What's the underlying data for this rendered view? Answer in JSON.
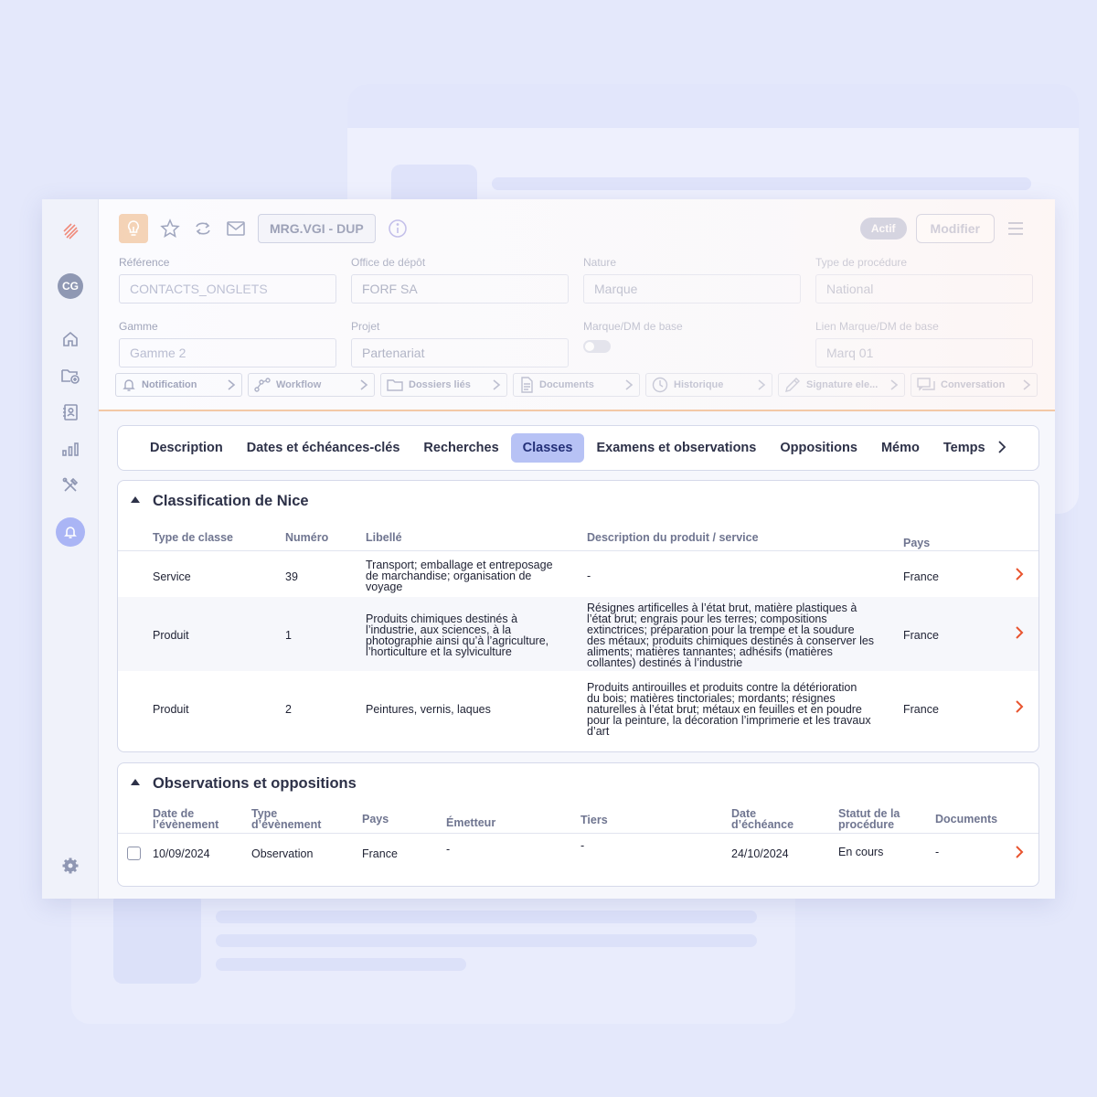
{
  "toolbar": {
    "reference_chip": "MRG.VGI - DUP",
    "status_badge": "Actif",
    "edit_button": "Modifier",
    "avatar_initials": "CG"
  },
  "fields": [
    {
      "label": "Référence",
      "value": "CONTACTS_ONGLETS"
    },
    {
      "label": "Office de dépôt",
      "value": "FORF SA"
    },
    {
      "label": "Nature",
      "value": "Marque"
    },
    {
      "label": "Type de procédure",
      "value": "National"
    },
    {
      "label": "Gamme",
      "value": "Gamme 2"
    },
    {
      "label": "Projet",
      "value": "Partenariat"
    },
    {
      "label": "Marque/DM de base",
      "value": ""
    },
    {
      "label": "Lien Marque/DM de base",
      "value": "Marq 01"
    }
  ],
  "actions": [
    {
      "label": "Notification",
      "icon": "bell-icon"
    },
    {
      "label": "Workflow",
      "icon": "workflow-icon"
    },
    {
      "label": "Dossiers liés",
      "icon": "folder-icon"
    },
    {
      "label": "Documents",
      "icon": "document-icon"
    },
    {
      "label": "Historique",
      "icon": "clock-icon"
    },
    {
      "label": "Signature ele...",
      "icon": "pen-icon"
    },
    {
      "label": "Conversation",
      "icon": "chat-icon"
    }
  ],
  "tabs": [
    {
      "label": "Description",
      "active": false
    },
    {
      "label": "Dates et échéances-clés",
      "active": false
    },
    {
      "label": "Recherches",
      "active": false
    },
    {
      "label": "Classes",
      "active": true
    },
    {
      "label": "Examens et observations",
      "active": false
    },
    {
      "label": "Oppositions",
      "active": false
    },
    {
      "label": "Mémo",
      "active": false
    },
    {
      "label": "Temps",
      "active": false
    }
  ],
  "nice": {
    "title": "Classification de Nice",
    "headers": {
      "type": "Type de classe",
      "numero": "Numéro",
      "libelle": "Libellé",
      "description": "Description du produit / service",
      "pays": "Pays"
    },
    "rows": [
      {
        "type": "Service",
        "numero": "39",
        "libelle": [
          "Transport; emballage et entreposage",
          "de marchandise; organisation de",
          "voyage"
        ],
        "description": [
          "-"
        ],
        "pays": "France"
      },
      {
        "type": "Produit",
        "numero": "1",
        "libelle": [
          "Produits chimiques destinés à",
          "l’industrie, aux sciences, à la",
          "photographie ainsi qu’à l’agriculture,",
          "l’horticulture et la sylviculture"
        ],
        "description": [
          "Résignes artificelles à l’état brut, matière plastiques à",
          "l’état brut; engrais pour les terres; compositions",
          "extinctrices; préparation pour la trempe et la soudure",
          "des métaux; produits chimiques destinés à conserver les",
          "aliments; matières tannantes; adhésifs (matières",
          "collantes) destinés à l’industrie"
        ],
        "pays": "France"
      },
      {
        "type": "Produit",
        "numero": "2",
        "libelle": [
          "Peintures, vernis, laques"
        ],
        "description": [
          "Produits antirouilles et produits contre la détérioration",
          "du bois; matières tinctoriales; mordants; résignes",
          "naturelles à l’état brut; métaux en feuilles et en poudre",
          "pour la peinture, la décoration l’imprimerie et les travaux",
          "d’art"
        ],
        "pays": "France"
      }
    ]
  },
  "obs": {
    "title": "Observations et oppositions",
    "headers": {
      "date": [
        "Date de",
        "l’évènement"
      ],
      "type": [
        "Type",
        "d’évènement"
      ],
      "pays": "Pays",
      "emetteur": "Émetteur",
      "tiers": "Tiers",
      "echeance": [
        "Date",
        "d’échéance"
      ],
      "statut": [
        "Statut de la",
        "procédure"
      ],
      "documents": "Documents"
    },
    "rows": [
      {
        "date": "10/09/2024",
        "type": "Observation",
        "pays": "France",
        "emetteur": "-",
        "tiers": "-",
        "echeance": "24/10/2024",
        "statut": "En cours",
        "documents": "-"
      }
    ]
  }
}
